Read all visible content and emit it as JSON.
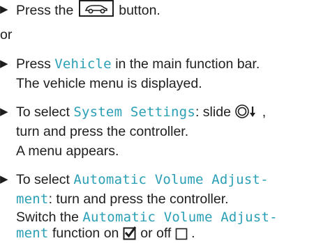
{
  "steps": {
    "s1": {
      "pre": "Press the",
      "icon": "vehicle-button-icon",
      "post": "button."
    },
    "or": "or",
    "s2": {
      "pre": "Press",
      "hl": "Vehicle",
      "post": "in the main function bar.",
      "line2": "The vehicle menu is displayed."
    },
    "s3": {
      "pre": "To select",
      "hl": "System Settings",
      "post": ": slide",
      "ctrl_icon": "controller-slide-down-icon",
      "post2": ",",
      "line2": "turn and press the controller.",
      "line3": "A menu appears."
    },
    "s4": {
      "pre": "To select",
      "hl1": "Automatic Volume Adjust-",
      "hl1b": "ment",
      "mid": ": turn and press the controller.",
      "line3a": "Switch the",
      "hl2": "Automatic Volume Adjust-",
      "hl2b": "ment",
      "line4a": "function on",
      "on_icon": "checkbox-checked-icon",
      "line4b": "or off",
      "off_icon": "checkbox-empty-icon",
      "end": "."
    },
    "bullet": "▶"
  },
  "colors": {
    "highlight": "#2a9fb5",
    "text": "#1e1e1e"
  }
}
